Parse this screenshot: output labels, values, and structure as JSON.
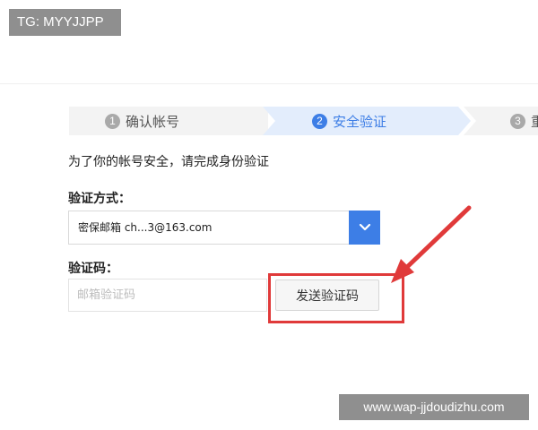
{
  "badge": {
    "text": "TG: MYYJJPP"
  },
  "steps": [
    {
      "num": "1",
      "label": "确认帐号",
      "state": "done"
    },
    {
      "num": "2",
      "label": "安全验证",
      "state": "active"
    },
    {
      "num": "3",
      "label": "重",
      "state": "pending"
    }
  ],
  "form": {
    "notice": "为了你的帐号安全，请完成身份验证",
    "method_label": "验证方式：",
    "method_value": "密保邮箱 ch...3@163.com",
    "code_label": "验证码：",
    "code_placeholder": "邮箱验证码",
    "code_value": "",
    "send_button": "发送验证码"
  },
  "colors": {
    "accent": "#3d7ee6",
    "active_step_bg": "#e3edfc",
    "highlight": "#e03a3a"
  },
  "icons": {
    "dropdown": "chevron-down-icon",
    "annotation": "red-arrow"
  },
  "watermark": {
    "text": "www.wap-jjdoudizhu.com"
  }
}
